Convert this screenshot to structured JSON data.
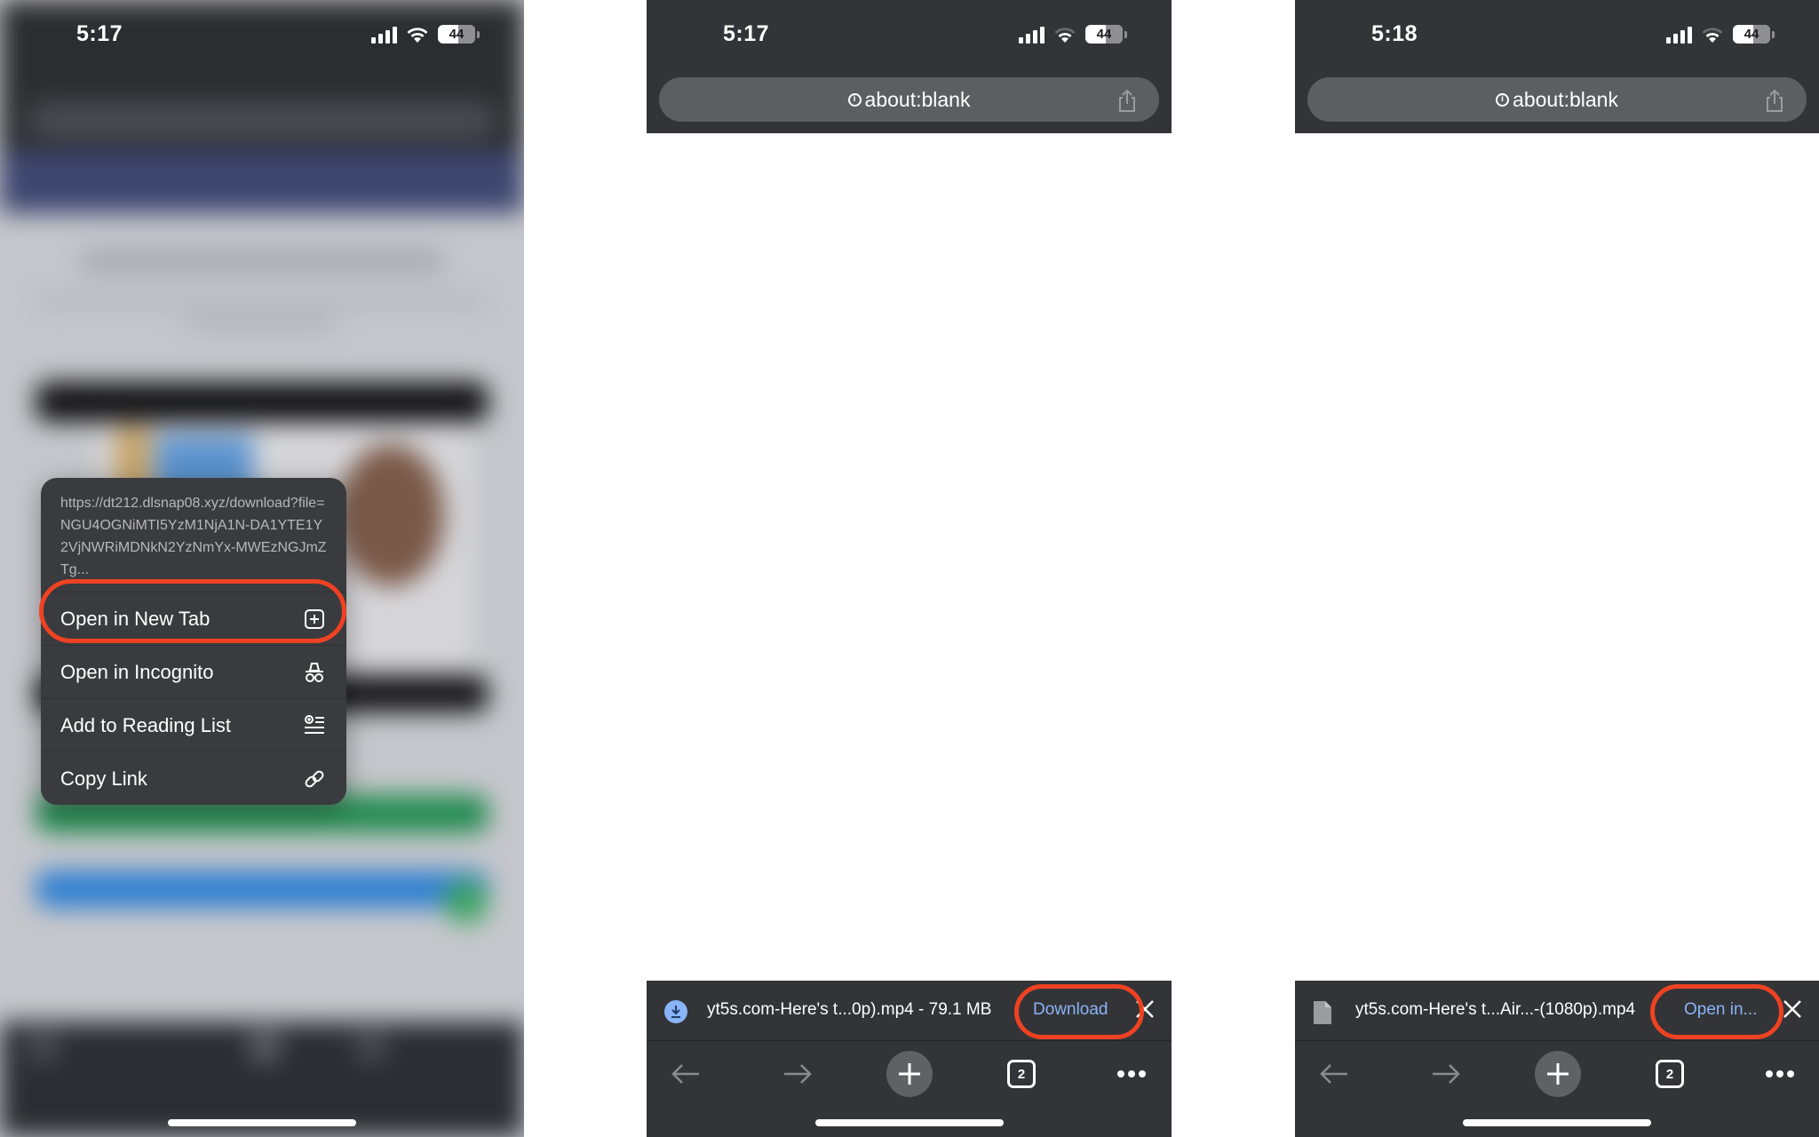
{
  "panels": [
    {
      "status": {
        "time": "5:17",
        "battery": "44"
      },
      "context_menu": {
        "url": "https://dt212.dlsnap08.xyz/download?file=NGU4OGNiMTI5YzM1NjA1N-DA1YTE1Y2VjNWRiMDNkN2YzNmYx-MWEzNGJmZTg...",
        "items": [
          {
            "label": "Open in New Tab",
            "icon": "new-tab-icon"
          },
          {
            "label": "Open in Incognito",
            "icon": "incognito-icon"
          },
          {
            "label": "Add to Reading List",
            "icon": "reading-list-icon"
          },
          {
            "label": "Copy Link",
            "icon": "link-icon"
          }
        ]
      }
    },
    {
      "status": {
        "time": "5:17",
        "battery": "44"
      },
      "url": "about:blank",
      "download": {
        "filename": "yt5s.com-Here's t...0p).mp4 - 79.1 MB",
        "action": "Download",
        "icon": "download-icon"
      },
      "toolbar": {
        "tab_count": "2"
      }
    },
    {
      "status": {
        "time": "5:18",
        "battery": "44"
      },
      "url": "about:blank",
      "download": {
        "filename": "yt5s.com-Here's t...Air...-(1080p).mp4",
        "action": "Open in...",
        "icon": "file-icon"
      },
      "toolbar": {
        "tab_count": "2"
      }
    }
  ],
  "colors": {
    "highlight": "#ef4222",
    "link_blue": "#8ab4f8",
    "chrome_dark": "#333437"
  }
}
